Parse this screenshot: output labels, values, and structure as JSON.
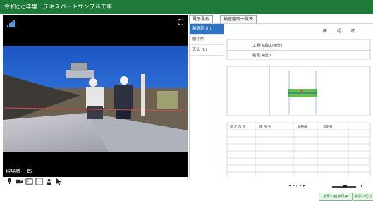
{
  "app": {
    "title": "令和○○年度　テキスパートサンプル工事"
  },
  "video": {
    "participant_name": "現場者 一郎"
  },
  "tabs": [
    {
      "label": "電子黒板"
    },
    {
      "label": "検査箇所一覧表"
    }
  ],
  "list_items": [
    {
      "label": "基礎部 (H)"
    },
    {
      "label": "胴 (W)"
    },
    {
      "label": "天上 (L)"
    }
  ],
  "document": {
    "header": [
      "確",
      "認",
      "印"
    ],
    "field1": "工 種 基礎工(擁壁)",
    "field2": "種 別 擁壁工",
    "table_header": [
      "測 定 項 目",
      "箇 所 名",
      "規格値",
      "測定値"
    ]
  },
  "pager": {
    "prev": "◀",
    "page": "1 / 1",
    "next": "▶"
  },
  "zoom": {
    "minus": "−",
    "plus": "+",
    "level": 0.5
  },
  "buttons": {
    "left": "撮影の画像保存",
    "right": "帳票の送付"
  }
}
